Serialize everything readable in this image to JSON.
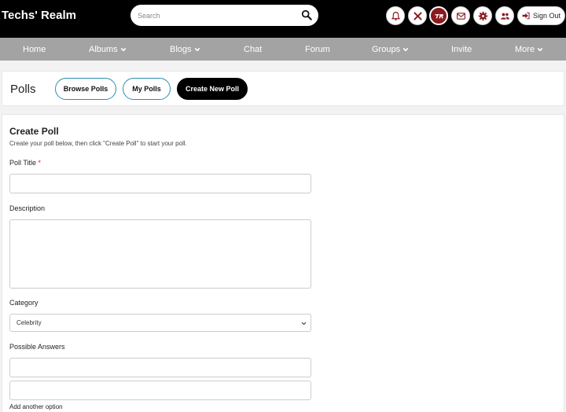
{
  "header": {
    "brand": "Techs' Realm",
    "search_placeholder": "Search",
    "signout_label": "Sign Out",
    "icons": [
      "bell-icon",
      "tools-icon",
      "logo-icon",
      "mail-icon",
      "gear-icon",
      "users-icon"
    ],
    "accent_color": "#8b1a1f"
  },
  "nav": {
    "home": "Home",
    "albums": "Albums",
    "blogs": "Blogs",
    "chat": "Chat",
    "forum": "Forum",
    "groups": "Groups",
    "invite": "Invite",
    "more": "More"
  },
  "polls": {
    "title": "Polls",
    "browse": "Browse Polls",
    "mine": "My Polls",
    "create": "Create New Poll"
  },
  "form": {
    "title": "Create Poll",
    "subtitle": "Create your poll below, then click \"Create Poll\" to start your poll.",
    "poll_title_label": "Poll Title",
    "required_mark": "*",
    "description_label": "Description",
    "category_label": "Category",
    "category_value": "Celebrity",
    "answers_label": "Possible Answers",
    "add_option": "Add another option"
  }
}
